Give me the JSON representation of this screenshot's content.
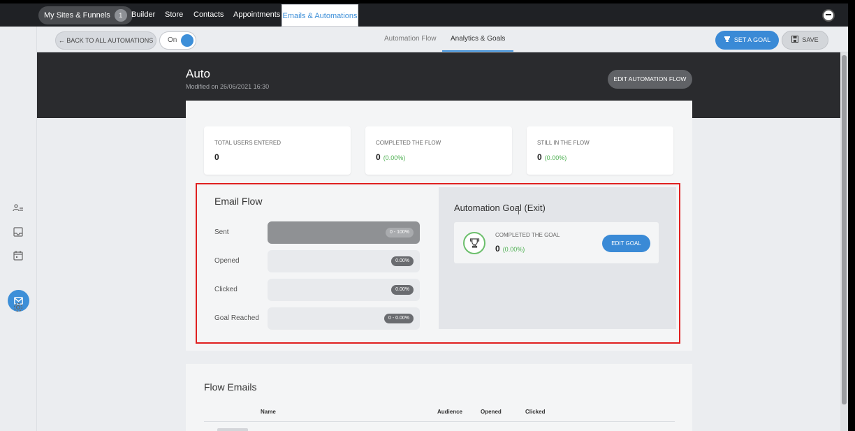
{
  "topnav": {
    "sites_label": "My Sites & Funnels",
    "sites_badge": "1",
    "links": [
      "Builder",
      "Store",
      "Contacts",
      "Appointments"
    ],
    "active_link": "Emails & Automations"
  },
  "toolbar": {
    "back_label": "← BACK TO ALL AUTOMATIONS",
    "toggle_label": "On",
    "tabs": [
      "Automation Flow",
      "Analytics & Goals"
    ],
    "set_goal_label": "SET A GOAL",
    "save_label": "SAVE"
  },
  "header": {
    "title": "Auto",
    "modified": "Modified on 26/06/2021 16:30",
    "edit_flow_label": "EDIT AUTOMATION FLOW"
  },
  "stats": [
    {
      "label": "TOTAL USERS ENTERED",
      "value": "0",
      "pct": ""
    },
    {
      "label": "COMPLETED THE FLOW",
      "value": "0",
      "pct": "(0.00%)"
    },
    {
      "label": "STILL IN THE FLOW",
      "value": "0",
      "pct": "(0.00%)"
    }
  ],
  "email_flow": {
    "title": "Email Flow",
    "rows": [
      {
        "label": "Sent",
        "value": "0 - 100%"
      },
      {
        "label": "Opened",
        "value": "0.00%"
      },
      {
        "label": "Clicked",
        "value": "0.00%"
      },
      {
        "label": "Goal Reached",
        "value": "0 - 0.00%"
      }
    ]
  },
  "goal": {
    "title": "Automation Goal (Exit)",
    "label": "COMPLETED THE GOAL",
    "value": "0",
    "pct": "(0.00%)",
    "edit_label": "EDIT GOAL"
  },
  "flow_emails": {
    "title": "Flow Emails",
    "columns": [
      "Name",
      "Audience",
      "Opened",
      "Clicked"
    ]
  },
  "colors": {
    "accent": "#3a8ad6",
    "highlight": "#e02020",
    "success": "#4caf50"
  }
}
